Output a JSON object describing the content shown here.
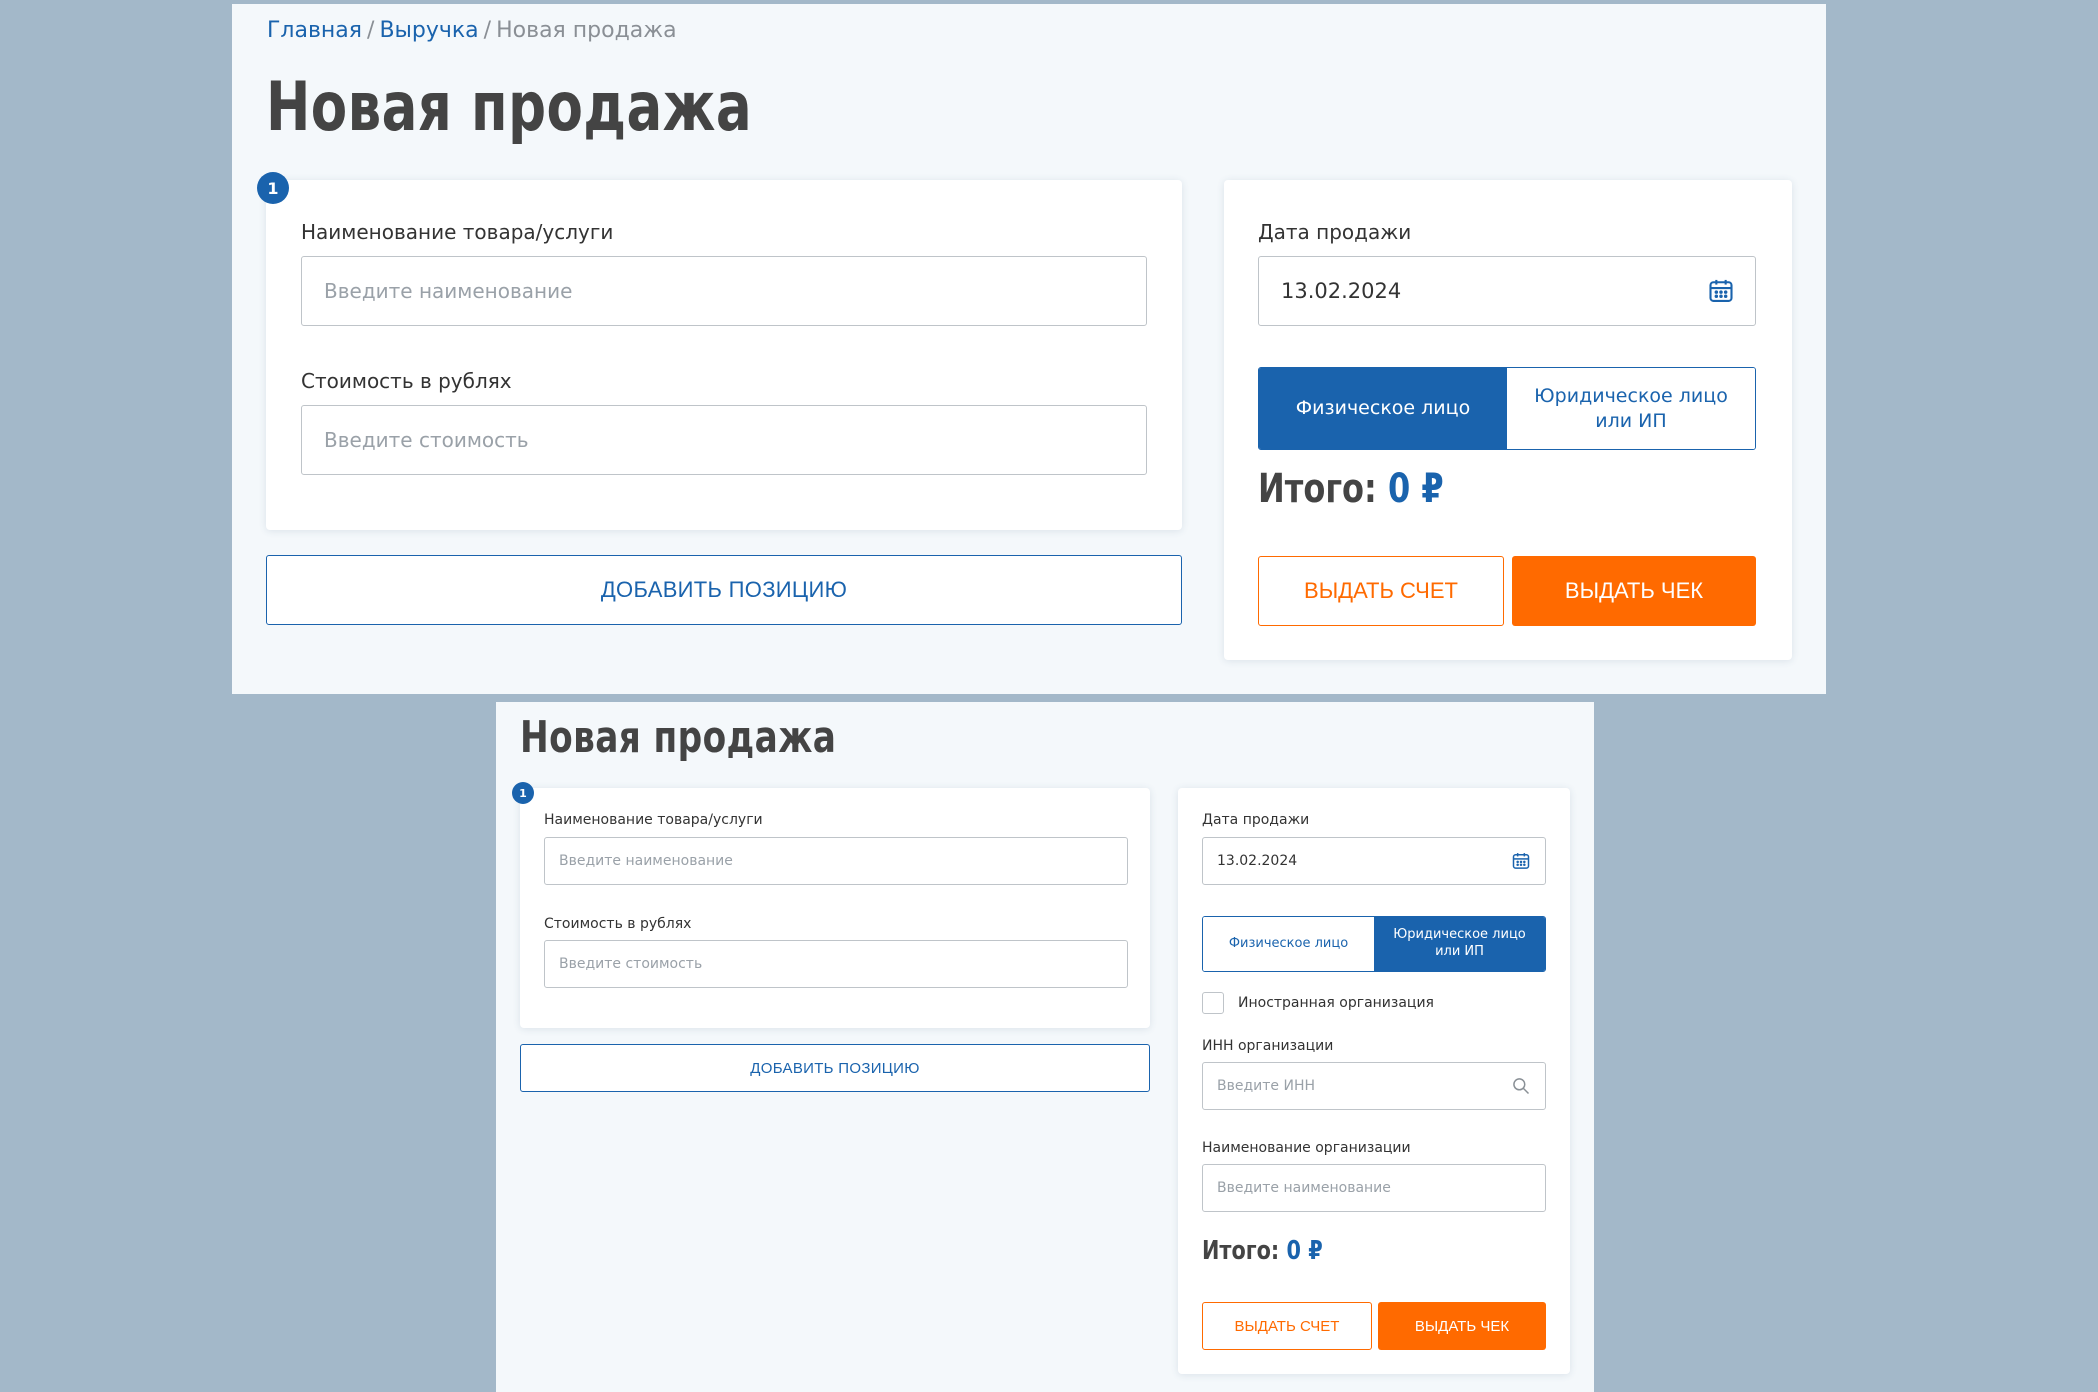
{
  "top": {
    "breadcrumb": [
      "Главная",
      "Выручка",
      "Новая продажа"
    ],
    "breadcrumb_sep": "/",
    "title": "Новая продажа",
    "badge": "1",
    "item_name_label": "Наименование товара/услуги",
    "item_name_placeholder": "Введите наименование",
    "price_label": "Стоимость в рублях",
    "price_placeholder": "Введите стоимость",
    "add_position": "ДОБАВИТЬ ПОЗИЦИЮ",
    "date_label": "Дата продажи",
    "date_value": "13.02.2024",
    "toggle_individual": "Физическое лицо",
    "toggle_legal": "Юридическое лицо или ИП",
    "selected_toggle": "individual",
    "total_label": "Итого:",
    "total_value": "0 ₽",
    "invoice_button": "ВЫДАТЬ СЧЕТ",
    "receipt_button": "ВЫДАТЬ ЧЕК"
  },
  "bottom": {
    "title": "Новая продажа",
    "badge": "1",
    "item_name_label": "Наименование товара/услуги",
    "item_name_placeholder": "Введите наименование",
    "price_label": "Стоимость в рублях",
    "price_placeholder": "Введите стоимость",
    "add_position": "ДОБАВИТЬ ПОЗИЦИЮ",
    "date_label": "Дата продажи",
    "date_value": "13.02.2024",
    "toggle_individual": "Физическое лицо",
    "toggle_legal": "Юридическое лицо или ИП",
    "selected_toggle": "legal",
    "foreign_org_label": "Иностранная организация",
    "inn_label": "ИНН организации",
    "inn_placeholder": "Введите ИНН",
    "org_name_label": "Наименование организации",
    "org_name_placeholder": "Введите наименование",
    "total_label": "Итого:",
    "total_value": "0 ₽",
    "invoice_button": "ВЫДАТЬ СЧЕТ",
    "receipt_button": "ВЫДАТЬ ЧЕК"
  },
  "colors": {
    "accent": "#1a63ad",
    "orange": "#ff6a00",
    "background": "#a3b8c9",
    "panel": "#f4f8fb"
  },
  "icons": [
    "calendar-icon",
    "search-icon"
  ]
}
